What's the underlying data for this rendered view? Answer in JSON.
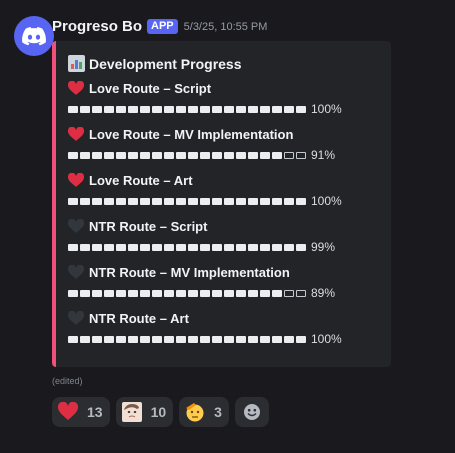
{
  "message": {
    "author": "Progreso Bo",
    "app_tag": "APP",
    "timestamp": "5/3/25, 10:55 PM",
    "edited_label": "(edited)"
  },
  "embed": {
    "accent_color": "#f0507a",
    "title": "Development Progress",
    "title_icon": "bar-chart-icon",
    "fields": [
      {
        "heart": "red-heart",
        "name": "Love Route – Script",
        "progress": 1.0,
        "percent_label": "100%"
      },
      {
        "heart": "red-heart",
        "name": "Love Route – MV Implementation",
        "progress": 0.91,
        "percent_label": "91%"
      },
      {
        "heart": "red-heart",
        "name": "Love Route – Art",
        "progress": 1.0,
        "percent_label": "100%"
      },
      {
        "heart": "black-heart",
        "name": "NTR Route – Script",
        "progress": 0.99,
        "percent_label": "99%"
      },
      {
        "heart": "black-heart",
        "name": "NTR Route – MV Implementation",
        "progress": 0.89,
        "percent_label": "89%"
      },
      {
        "heart": "black-heart",
        "name": "NTR Route – Art",
        "progress": 1.0,
        "percent_label": "100%"
      }
    ],
    "bar_segments": 20
  },
  "reactions": [
    {
      "emoji": "red-heart-emoji",
      "count": "13"
    },
    {
      "emoji": "custom-face-emoji",
      "count": "10"
    },
    {
      "emoji": "saluting-face-emoji",
      "count": "3"
    }
  ],
  "add_reaction_icon": "add-reaction-icon"
}
